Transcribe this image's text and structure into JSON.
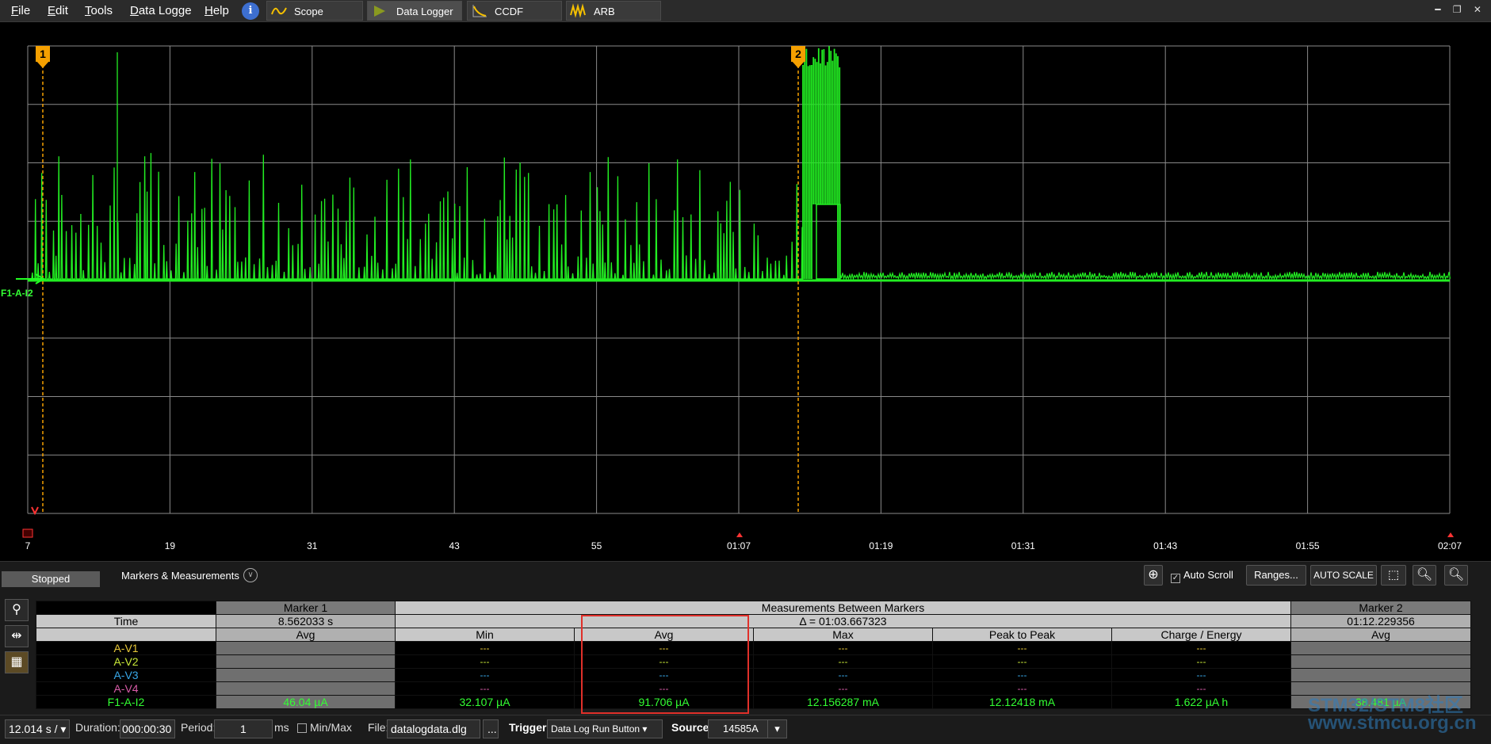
{
  "menu": {
    "file": "File",
    "edit": "Edit",
    "tools": "Tools",
    "datalogger": "Data Logge",
    "help": "Help"
  },
  "tabs": [
    {
      "label": "Scope",
      "icon": "sine-wave-icon"
    },
    {
      "label": "Data Logger",
      "icon": "play-icon"
    },
    {
      "label": "CCDF",
      "icon": "ccdf-icon"
    },
    {
      "label": "ARB",
      "icon": "arb-icon"
    }
  ],
  "plot": {
    "trace_label": "F1-A-I2",
    "marker1_label": "1",
    "marker2_label": "2",
    "x_ticks": [
      "7",
      "19",
      "31",
      "43",
      "55",
      "01:07",
      "01:19",
      "01:31",
      "01:43",
      "01:55",
      "02:07"
    ],
    "trace_color": "#22ee22",
    "marker_color": "#f5a000"
  },
  "chart_data": {
    "type": "line",
    "title": "",
    "xlabel": "",
    "ylabel": "",
    "x_ticks": [
      "7",
      "19",
      "31",
      "43",
      "55",
      "01:07",
      "01:19",
      "01:31",
      "01:43",
      "01:55",
      "02:07"
    ],
    "series": [
      {
        "name": "F1-A-I2",
        "color": "#22ee22"
      }
    ],
    "grid": true,
    "markers": [
      {
        "name": "1",
        "time_s": 8.562033
      },
      {
        "name": "2",
        "time": "01:12.229356"
      }
    ]
  },
  "toolbar": {
    "status": "Stopped",
    "markers_label": "Markers & Measurements",
    "auto_scroll": "Auto Scroll",
    "ranges": "Ranges...",
    "autoscale": "AUTO SCALE"
  },
  "table": {
    "marker1": "Marker 1",
    "between": "Measurements Between Markers",
    "marker2": "Marker 2",
    "time": "Time",
    "m1_time": "8.562033 s",
    "delta": "Δ = 01:03.667323",
    "m2_time": "01:12.229356",
    "cols": [
      "Avg",
      "Min",
      "Avg",
      "Max",
      "Peak to Peak",
      "Charge / Energy",
      "Avg"
    ],
    "rows": [
      {
        "name": "A-V1",
        "color": "#e8c838",
        "vals": [
          "",
          "---",
          "---",
          "---",
          "---",
          "---",
          ""
        ]
      },
      {
        "name": "A-V2",
        "color": "#c8e838",
        "vals": [
          "",
          "---",
          "---",
          "---",
          "---",
          "---",
          ""
        ]
      },
      {
        "name": "A-V3",
        "color": "#38a8e8",
        "vals": [
          "",
          "---",
          "---",
          "---",
          "---",
          "---",
          ""
        ]
      },
      {
        "name": "A-V4",
        "color": "#d85ca8",
        "vals": [
          "",
          "---",
          "---",
          "---",
          "---",
          "---",
          ""
        ]
      },
      {
        "name": "F1-A-I2",
        "color": "#33ff33",
        "vals": [
          "46.04 µA",
          "32.107 µA",
          "91.706 µA",
          "12.156287 mA",
          "12.12418 mA",
          "1.622 µA h",
          "38.481 µA"
        ]
      }
    ]
  },
  "bottom": {
    "scale": "12.014 s /",
    "duration_label": "Duration:",
    "duration": "000:00:30",
    "period_label": "Period:",
    "period": "1",
    "period_unit": "ms",
    "minmax": "Min/Max",
    "file_label": "File:",
    "file": "datalogdata.dlg",
    "browse": "...",
    "trigger_label": "Trigger",
    "trigger": "Data Log Run Button",
    "source_label": "Source",
    "source": "14585A"
  },
  "watermark": {
    "line1": "STM32/STM8社区",
    "line2": "www.stmcu.org.cn"
  }
}
